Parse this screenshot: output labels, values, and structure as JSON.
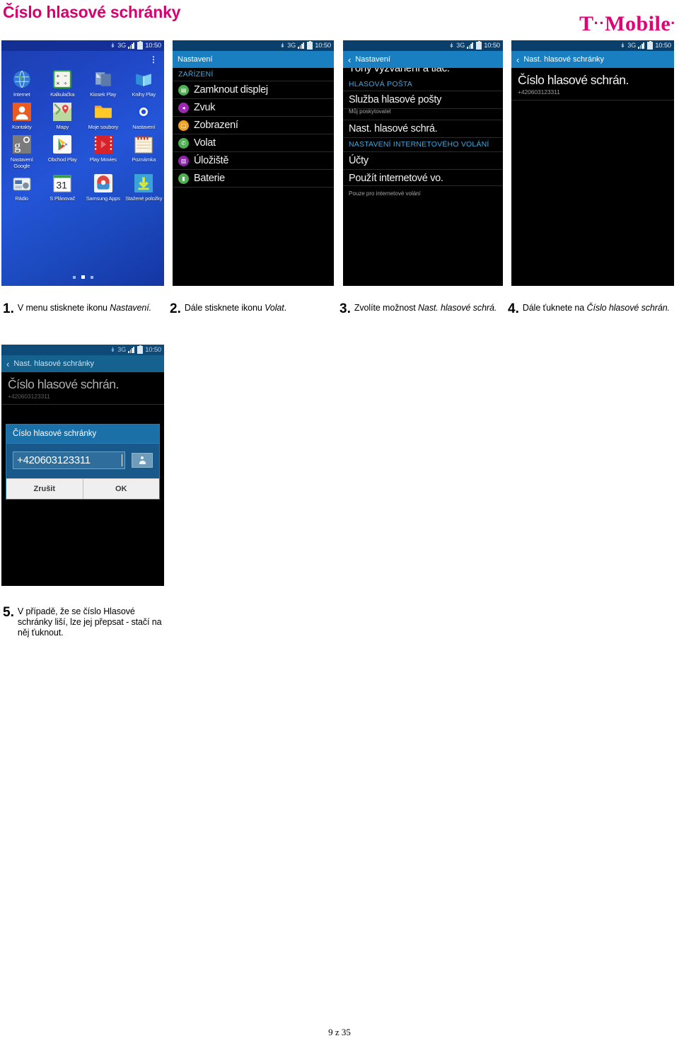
{
  "header": {
    "title": "Číslo hlasové schránky",
    "logo_text": "T",
    "logo_brand": "Mobile",
    "logo_dot": "·"
  },
  "status_bar": {
    "network_icon": "nfc-icon",
    "data_label": "3G",
    "signal_icon": "signal-bars-icon",
    "battery_icon": "battery-icon",
    "time": "10:50"
  },
  "screens": {
    "home": {
      "menu_icon": "overflow-menu-icon",
      "apps": [
        {
          "label": "Internet",
          "icon": "globe-icon",
          "color": "#2f6fd0",
          "glyph": "ἱ0"
        },
        {
          "label": "Kalkulačka",
          "icon": "calculator-icon",
          "color": "#f3f3ef",
          "glyph": ""
        },
        {
          "label": "Kiosek Play",
          "icon": "newsstand-icon",
          "color": "#5d7ba8",
          "glyph": ""
        },
        {
          "label": "Knihy Play",
          "icon": "books-icon",
          "color": "#2f8fd8",
          "glyph": ""
        },
        {
          "label": "Kontakty",
          "icon": "contacts-icon",
          "color": "#eb5a1e",
          "glyph": ""
        },
        {
          "label": "Mapy",
          "icon": "maps-icon",
          "color": "#e6e4d6",
          "glyph": ""
        },
        {
          "label": "Moje soubory",
          "icon": "folder-icon",
          "color": "#ffc107",
          "glyph": ""
        },
        {
          "label": "Nastavení",
          "icon": "gear-icon",
          "color": "#1f4fd0",
          "glyph": ""
        },
        {
          "label": "Nastavení Google",
          "icon": "google-settings-icon",
          "color": "#7b7b7b",
          "glyph": ""
        },
        {
          "label": "Obchod Play",
          "icon": "play-store-icon",
          "color": "#f6f6f6",
          "glyph": ""
        },
        {
          "label": "Play Movies",
          "icon": "play-movies-icon",
          "color": "#d8222a",
          "glyph": ""
        },
        {
          "label": "Poznámka",
          "icon": "memo-icon",
          "color": "#f4e7cd",
          "glyph": ""
        },
        {
          "label": "Rádio",
          "icon": "radio-icon",
          "color": "#e9eef2",
          "glyph": ""
        },
        {
          "label": "S Plánovač",
          "icon": "calendar-icon",
          "color": "#ffffff",
          "glyph": "31"
        },
        {
          "label": "Samsung Apps",
          "icon": "samsung-apps-icon",
          "color": "#f0f0f0",
          "glyph": ""
        },
        {
          "label": "Stažené položky",
          "icon": "downloads-icon",
          "color": "#2f9fd8",
          "glyph": ""
        }
      ],
      "page_dots": 3,
      "active_dot": 1
    },
    "settings": {
      "action_title": "Nastavení",
      "section": "ZAŘÍZENÍ",
      "rows": [
        {
          "label": "Zamknout displej",
          "icon": "lockscreen-icon",
          "color": "#4caf50"
        },
        {
          "label": "Zvuk",
          "icon": "sound-icon",
          "color": "#9c27b0"
        },
        {
          "label": "Zobrazení",
          "icon": "display-icon",
          "color": "#f0a022"
        },
        {
          "label": "Volat",
          "icon": "phone-icon",
          "color": "#4caf50"
        },
        {
          "label": "Úložiště",
          "icon": "storage-icon",
          "color": "#8e24aa"
        },
        {
          "label": "Baterie",
          "icon": "battery-icon",
          "color": "#4caf50"
        }
      ]
    },
    "call_settings": {
      "action_title": "Nastavení",
      "back_icon": "chevron-left-icon",
      "clipped_row": "Tóny vyzvánění a tlač.",
      "section_voicemail": "HLASOVÁ POŠTA",
      "rows": [
        {
          "label": "Služba hlasové pošty",
          "sub": "Můj poskytovatel"
        },
        {
          "label": "Nast. hlasové schrá.",
          "sub": ""
        }
      ],
      "section_internet": "NASTAVENÍ INTERNETOVÉHO VOLÁNÍ",
      "rows2": [
        {
          "label": "Účty",
          "sub": ""
        },
        {
          "label": "Použít internetové vo.",
          "sub": "Pouze pro internetové volání"
        }
      ]
    },
    "voicemail_settings": {
      "action_title": "Nast. hlasové schránky",
      "back_icon": "chevron-left-icon",
      "item_label": "Číslo hlasové schrán.",
      "item_value": "+420603123311"
    },
    "voicemail_dialog": {
      "action_title": "Nast. hlasové schránky",
      "back_icon": "chevron-left-icon",
      "item_label": "Číslo hlasové schrán.",
      "item_value": "+420603123311",
      "dialog_title": "Číslo hlasové schránky",
      "input_value": "+420603123311",
      "contact_icon": "contact-picker-icon",
      "cancel_label": "Zrušit",
      "ok_label": "OK"
    }
  },
  "steps": [
    {
      "number": "1.",
      "text_plain": "V menu stisknete ikonu ",
      "text_italic": "Nastavení.",
      "text_tail": ""
    },
    {
      "number": "2.",
      "text_plain": "Dále stisknete ikonu ",
      "text_italic": "Volat",
      "text_tail": "."
    },
    {
      "number": "3.",
      "text_plain": "Zvolíte možnost ",
      "text_italic": "Nast. hlasové schrá.",
      "text_tail": ""
    },
    {
      "number": "4.",
      "text_plain": "Dále ťuknete na ",
      "text_italic": "Číslo hlasové schrán.",
      "text_tail": ""
    },
    {
      "number": "5.",
      "text_plain": "V případě, že se číslo Hlasové schránky liší, lze jej přepsat - stačí na něj ťuknout.",
      "text_italic": "",
      "text_tail": ""
    }
  ],
  "footer": {
    "page_label": "9 z 35"
  },
  "colors": {
    "brand_magenta": "#e20074",
    "title_magenta": "#d6006e",
    "android_blue": "#1a7fc1",
    "status_blue": "#0b3f6b"
  }
}
